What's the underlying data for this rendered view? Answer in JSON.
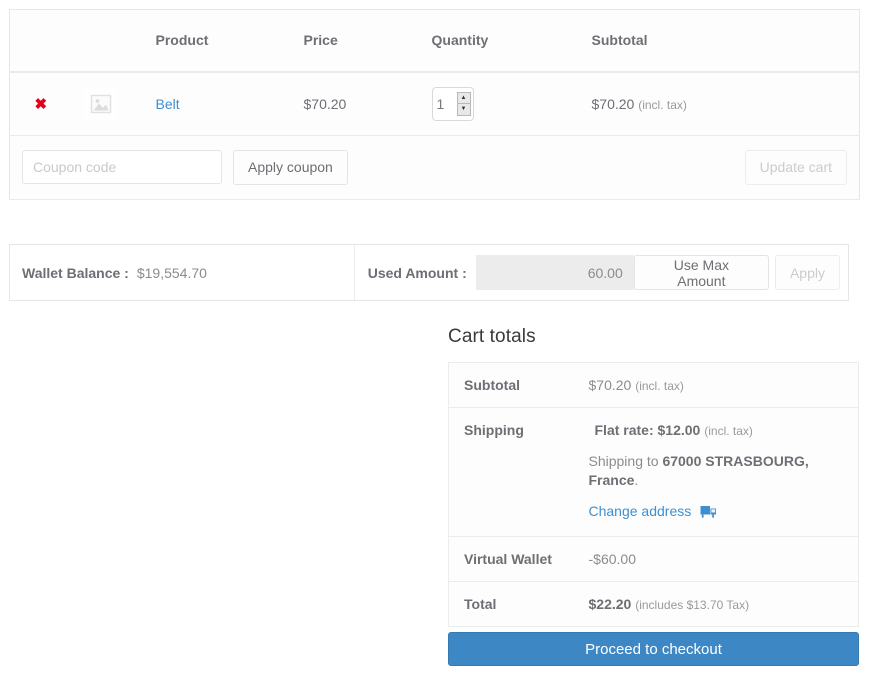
{
  "cart_table": {
    "headers": [
      "",
      "",
      "Product",
      "Price",
      "Quantity",
      "Subtotal"
    ],
    "rows": [
      {
        "remove_icon": "remove-x-icon",
        "remove_label": "✖",
        "thumbnail": "image-placeholder-icon",
        "product": "Belt",
        "price": "$70.20",
        "quantity": "1",
        "subtotal": "$70.20",
        "subtotal_note": "(incl. tax)"
      }
    ],
    "coupon": {
      "placeholder": "Coupon code",
      "value": "",
      "apply_label": "Apply coupon",
      "update_label": "Update cart",
      "update_disabled": true
    }
  },
  "wallet": {
    "balance_label": "Wallet Balance :",
    "balance_value": "$19,554.70",
    "used_label": "Used Amount :",
    "used_value": "60.00",
    "use_max_label": "Use Max Amount",
    "apply_label": "Apply",
    "apply_disabled": true
  },
  "cart_totals": {
    "title": "Cart totals",
    "subtotal": {
      "label": "Subtotal",
      "value": "$70.20",
      "note": "(incl. tax)"
    },
    "shipping": {
      "label": "Shipping",
      "method": "Flat rate: $12.00",
      "method_note": "(incl. tax)",
      "dest_prefix": "Shipping to ",
      "dest_place": "67000 STRASBOURG, France",
      "dest_suffix": ".",
      "change_address_label": "Change address",
      "truck_icon": "delivery-truck-icon"
    },
    "virtual_wallet": {
      "label": "Virtual Wallet",
      "value": "-$60.00"
    },
    "total": {
      "label": "Total",
      "value": "$22.20",
      "note": "(includes $13.70 Tax)"
    }
  },
  "checkout": {
    "label": "Proceed to checkout"
  },
  "colors": {
    "link": "#3f8fd0",
    "accent_button": "#3d87c4",
    "remove": "#e2001a",
    "text": "#6d6f74",
    "muted": "#9a9a9a",
    "input_disabled_bg": "#ececec"
  }
}
